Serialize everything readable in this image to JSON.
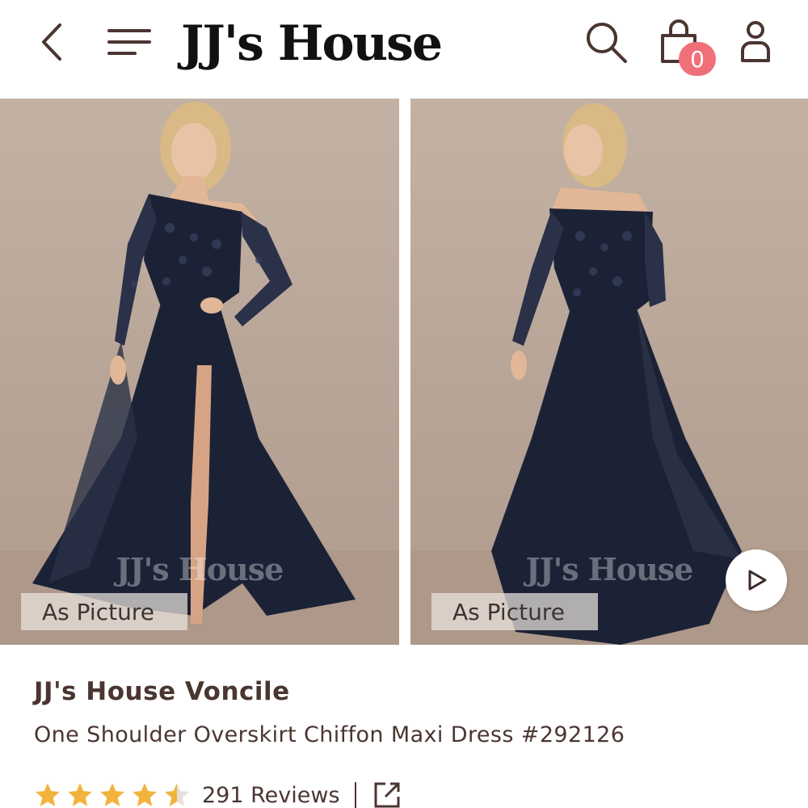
{
  "header": {
    "logo_text": "JJ's House",
    "cart_count": "0",
    "icons": [
      "back-icon",
      "menu-icon",
      "search-icon",
      "bag-icon",
      "account-icon"
    ]
  },
  "gallery": {
    "images": [
      {
        "watermark": "JJ's House",
        "tag": "As Picture"
      },
      {
        "watermark": "JJ's House",
        "tag": "As Picture"
      }
    ]
  },
  "product": {
    "brand_title": "JJ's House Voncile",
    "name": "One Shoulder Overskirt Chiffon Maxi Dress #292126",
    "rating": 4.5,
    "reviews": "291 Reviews"
  },
  "colors": {
    "accent": "#f0707a",
    "text": "#4b3531",
    "star": "#f2b33d",
    "photo_bg": "#bba99b",
    "dress": "#1c2236"
  }
}
